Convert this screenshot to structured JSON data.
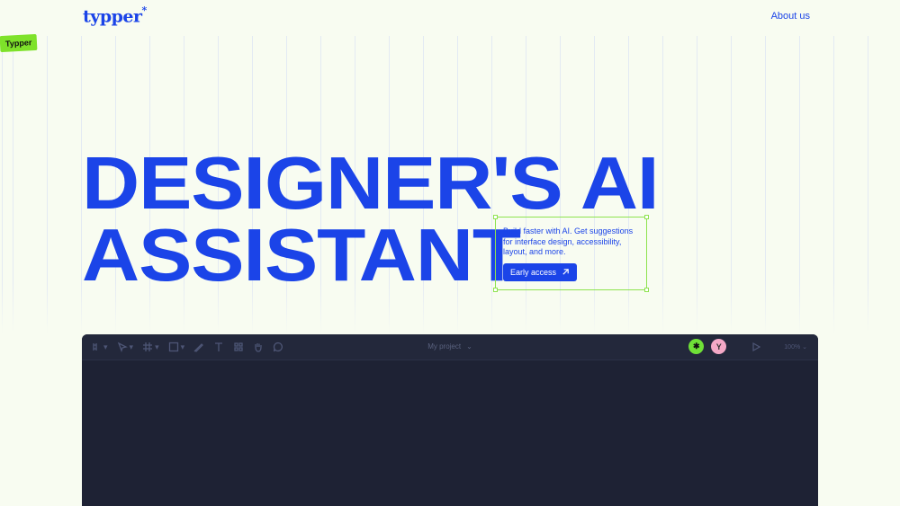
{
  "brand": {
    "logo_text": "typper",
    "logo_mark": "*"
  },
  "nav": {
    "about": "About us"
  },
  "tag": {
    "label": "Typper"
  },
  "hero": {
    "line1": "DESIGNER'S AI",
    "line2": "ASSISTANT",
    "description": "Build faster with AI. Get suggestions for interface design, accessibility, layout, and more.",
    "cta_label": "Early access"
  },
  "app": {
    "project_name": "My project",
    "avatars": [
      "✱",
      "Y"
    ],
    "zoom": "100%",
    "tools": [
      "move-icon",
      "pointer-icon",
      "frame-icon",
      "shape-icon",
      "pen-icon",
      "text-icon",
      "components-icon",
      "hand-icon",
      "comment-icon"
    ]
  },
  "colors": {
    "brand_blue": "#1b44e8",
    "accent_green": "#7ee22a",
    "app_bg": "#1e2234"
  }
}
